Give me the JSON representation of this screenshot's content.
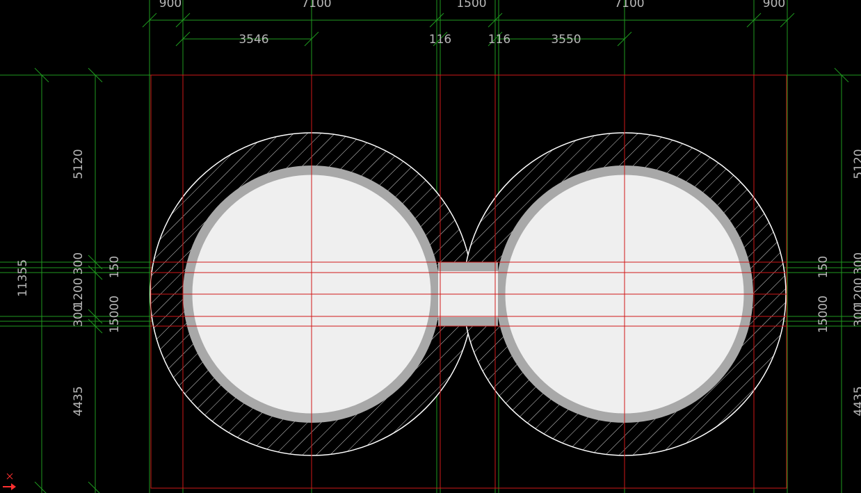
{
  "top_dims_row1": [
    "900",
    "7100",
    "1500",
    "7100",
    "900"
  ],
  "top_dims_row2": [
    "3546",
    "116",
    "116",
    "3550"
  ],
  "left_dims": {
    "total": "11355",
    "upper": "5120",
    "lower": "4435",
    "band_top": "300",
    "band_mid": "1200",
    "band_bottom": "300",
    "small_a": "150",
    "small_b": "15000"
  },
  "right_dims": {
    "upper": "5120",
    "lower": "4435",
    "band_top": "300",
    "band_mid": "1200",
    "band_bottom": "300",
    "small_a": "150",
    "small_b": "15000"
  },
  "colors": {
    "background": "#000000",
    "dim_line": "#1f9a1f",
    "axis_line": "#d01818",
    "outline": "#ffffff",
    "fill": "#efefef",
    "ring": "#a8a8a8",
    "text": "#b8b8b8"
  },
  "icons": [
    "ucs-axis-icon"
  ]
}
